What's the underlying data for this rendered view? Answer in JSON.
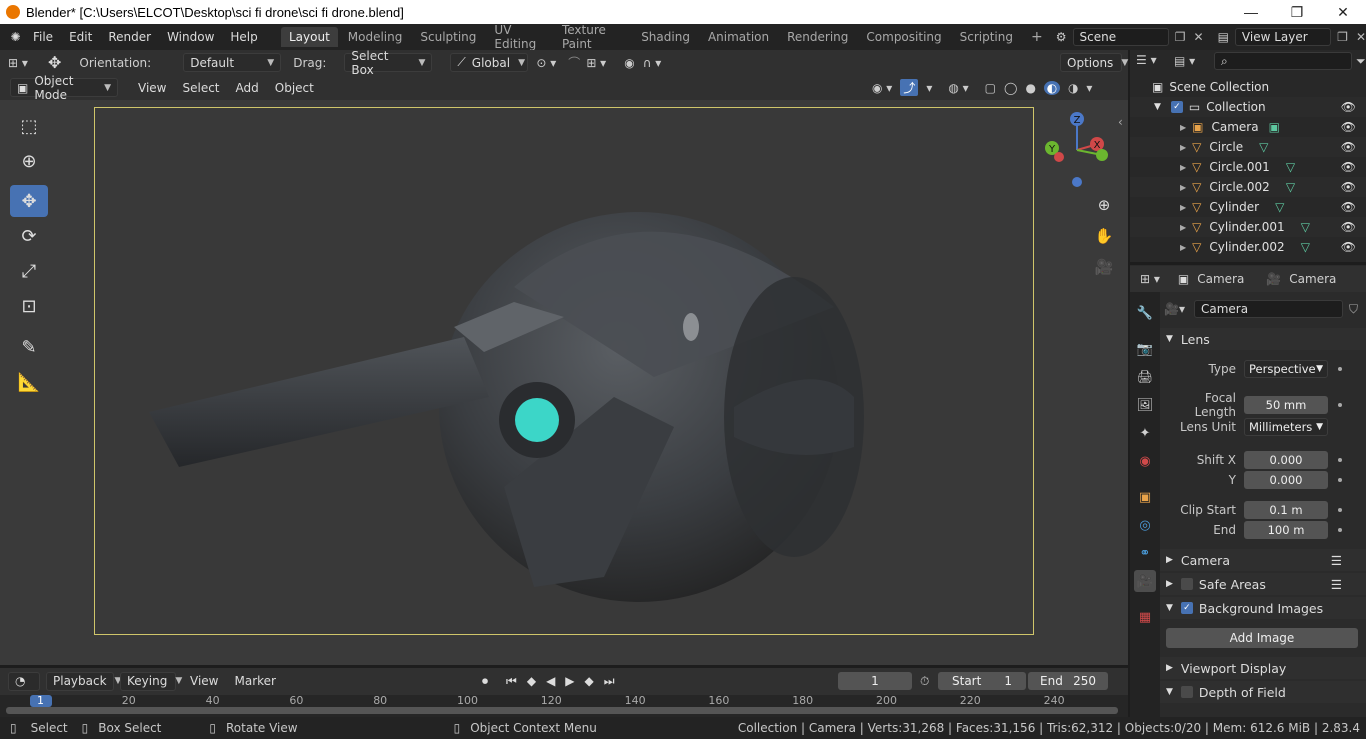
{
  "window": {
    "title": "Blender* [C:\\Users\\ELCOT\\Desktop\\sci fi drone\\sci fi drone.blend]",
    "minimize": "—",
    "maximize": "❐",
    "close": "✕"
  },
  "menu": [
    "File",
    "Edit",
    "Render",
    "Window",
    "Help"
  ],
  "workspaces": [
    "Layout",
    "Modeling",
    "Sculpting",
    "UV Editing",
    "Texture Paint",
    "Shading",
    "Animation",
    "Rendering",
    "Compositing",
    "Scripting"
  ],
  "workspace_add": "+",
  "scene": {
    "name": "Scene",
    "view_layer": "View Layer"
  },
  "tool_header": {
    "orientation_label": "Orientation:",
    "orientation_value": "Default",
    "drag_label": "Drag:",
    "drag_value": "Select Box",
    "transform_space": "Global",
    "options": "Options"
  },
  "mode_header": {
    "mode": "Object Mode",
    "menus": [
      "View",
      "Select",
      "Add",
      "Object"
    ]
  },
  "gizmo": {
    "z": "Z",
    "x": "X",
    "y": "Y"
  },
  "timeline": {
    "menus": [
      "Playback",
      "Keying",
      "View",
      "Marker"
    ],
    "current_frame": "1",
    "start_label": "Start",
    "start_value": "1",
    "end_label": "End",
    "end_value": "250",
    "ruler_ticks": [
      "1",
      "20",
      "40",
      "60",
      "80",
      "100",
      "120",
      "140",
      "160",
      "180",
      "200",
      "220",
      "240"
    ]
  },
  "status": {
    "select": "Select",
    "box_select": "Box Select",
    "rotate_view": "Rotate View",
    "context_menu": "Object Context Menu",
    "stats": "Collection | Camera | Verts:31,268 | Faces:31,156 | Tris:62,312 | Objects:0/20 | Mem: 612.6 MiB | 2.83.4"
  },
  "outliner": {
    "root": "Scene Collection",
    "collection": "Collection",
    "items": [
      "Camera",
      "Circle",
      "Circle.001",
      "Circle.002",
      "Cylinder",
      "Cylinder.001",
      "Cylinder.002"
    ]
  },
  "properties": {
    "breadcrumb_object": "Camera",
    "breadcrumb_data": "Camera",
    "datablock": "Camera",
    "lens_header": "Lens",
    "type_label": "Type",
    "type_value": "Perspective",
    "focal_label": "Focal Length",
    "focal_value": "50 mm",
    "lens_unit_label": "Lens Unit",
    "lens_unit_value": "Millimeters",
    "shift_x_label": "Shift X",
    "shift_x_value": "0.000",
    "shift_y_label": "Y",
    "shift_y_value": "0.000",
    "clip_start_label": "Clip Start",
    "clip_start_value": "0.1 m",
    "clip_end_label": "End",
    "clip_end_value": "100 m",
    "camera_panel": "Camera",
    "safe_areas_panel": "Safe Areas",
    "bg_images_panel": "Background Images",
    "add_image": "Add Image",
    "viewport_display_panel": "Viewport Display",
    "dof_panel": "Depth of Field"
  },
  "colors": {
    "accent": "#4772b3",
    "camera_frame": "#cfc56a",
    "mesh_icon": "#e8a34a",
    "data_icon": "#5ec8a0"
  }
}
